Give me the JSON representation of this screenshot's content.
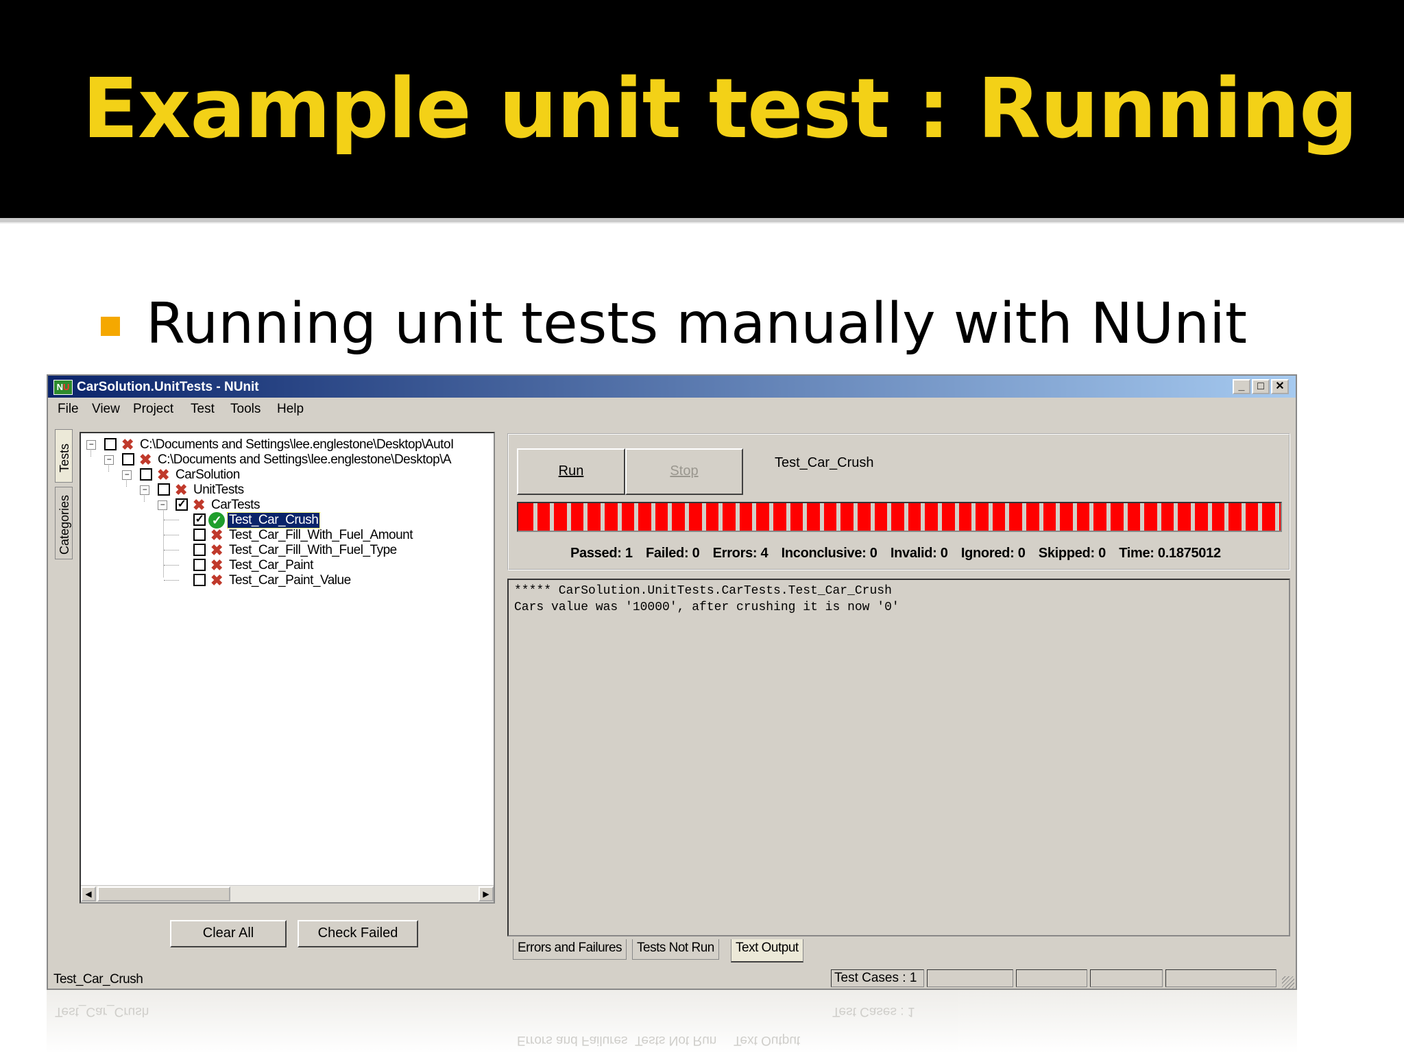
{
  "slide": {
    "title": "Example unit test : Running",
    "bullet": "Running unit tests manually with NUnit",
    "colors": {
      "title": "#f3d117",
      "bullet": "#f5a800",
      "progress": "#ff0000"
    }
  },
  "window": {
    "title": "CarSolution.UnitTests - NUnit",
    "icon_text": "NU",
    "controls": {
      "minimize": "_",
      "maximize": "□",
      "close": "✕"
    },
    "menu": [
      "File",
      "View",
      "Project",
      "Test",
      "Tools",
      "Help"
    ]
  },
  "side_tabs": {
    "tests": "Tests",
    "categories": "Categories"
  },
  "tree": {
    "nodes": [
      {
        "label": "C:\\Documents and Settings\\lee.englestone\\Desktop\\AutoI",
        "checked": false,
        "status": "failed"
      },
      {
        "label": "C:\\Documents and Settings\\lee.englestone\\Desktop\\A",
        "checked": false,
        "status": "failed"
      },
      {
        "label": "CarSolution",
        "checked": false,
        "status": "failed"
      },
      {
        "label": "UnitTests",
        "checked": false,
        "status": "failed"
      },
      {
        "label": "CarTests",
        "checked": true,
        "status": "failed"
      },
      {
        "label": "Test_Car_Crush",
        "checked": true,
        "status": "passed",
        "selected": true
      },
      {
        "label": "Test_Car_Fill_With_Fuel_Amount",
        "checked": false,
        "status": "failed"
      },
      {
        "label": "Test_Car_Fill_With_Fuel_Type",
        "checked": false,
        "status": "failed"
      },
      {
        "label": "Test_Car_Paint",
        "checked": false,
        "status": "failed"
      },
      {
        "label": "Test_Car_Paint_Value",
        "checked": false,
        "status": "failed"
      }
    ],
    "scroll": {
      "left": "◀",
      "right": "▶"
    }
  },
  "left_buttons": {
    "clear_all": "Clear All",
    "check_failed": "Check Failed"
  },
  "run_panel": {
    "run": "Run",
    "stop": "Stop",
    "current_test": "Test_Car_Crush",
    "progress_percent": 100,
    "summary": {
      "passed": "Passed: 1",
      "failed": "Failed: 0",
      "errors": "Errors: 4",
      "inconclusive": "Inconclusive: 0",
      "invalid": "Invalid: 0",
      "ignored": "Ignored: 0",
      "skipped": "Skipped: 0",
      "time": "Time: 0.1875012"
    }
  },
  "output": {
    "lines": [
      "***** CarSolution.UnitTests.CarTests.Test_Car_Crush",
      "Cars value was '10000', after crushing it is now '0'"
    ]
  },
  "result_tabs": [
    "Errors and Failures",
    "Tests Not Run",
    "Text Output"
  ],
  "status_bar": {
    "left": "Test_Car_Crush",
    "test_cases": "Test Cases : 1"
  }
}
